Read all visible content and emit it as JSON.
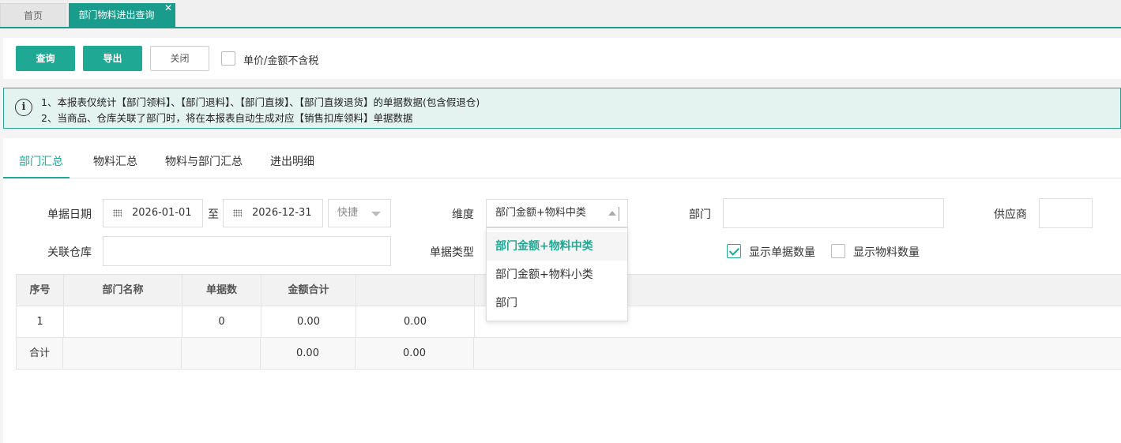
{
  "tabs": {
    "home": "首页",
    "active": "部门物料进出查询",
    "close": "✕"
  },
  "toolbar": {
    "query": "查询",
    "export": "导出",
    "close": "关闭",
    "exclude_tax_label": "单价/金额不含税"
  },
  "notice": {
    "line1": "1、本报表仅统计【部门领料】、【部门退料】、【部门直拨】、【部门直拨退货】的单据数据(包含假退仓)",
    "line2": "2、当商品、仓库关联了部门时，将在本报表自动生成对应【销售扣库领料】单据数据"
  },
  "report_tabs": [
    "部门汇总",
    "物料汇总",
    "物料与部门汇总",
    "进出明细"
  ],
  "filters": {
    "date_label": "单据日期",
    "date_from": "2026-01-01",
    "to_label": "至",
    "date_to": "2026-12-31",
    "quick_label": "快捷",
    "dimension_label": "维度",
    "dimension_value": "部门金额+物料中类",
    "dept_label": "部门",
    "supplier_label": "供应商",
    "warehouse_label": "关联仓库",
    "doctype_label": "单据类型",
    "show_doc_qty": "显示单据数量",
    "show_item_qty": "显示物料数量"
  },
  "dimension_options": [
    "部门金额+物料中类",
    "部门金额+物料小类",
    "部门"
  ],
  "table": {
    "headers": [
      "序号",
      "部门名称",
      "单据数",
      "金额合计",
      ""
    ],
    "rows": [
      [
        "1",
        "",
        "0",
        "0.00",
        "0.00"
      ]
    ],
    "total": [
      "合计",
      "",
      "",
      "0.00",
      "0.00"
    ]
  },
  "colors": {
    "accent": "#1fa994",
    "tab_active": "#1a9c8c",
    "notice_bg": "#e4f3ef"
  }
}
